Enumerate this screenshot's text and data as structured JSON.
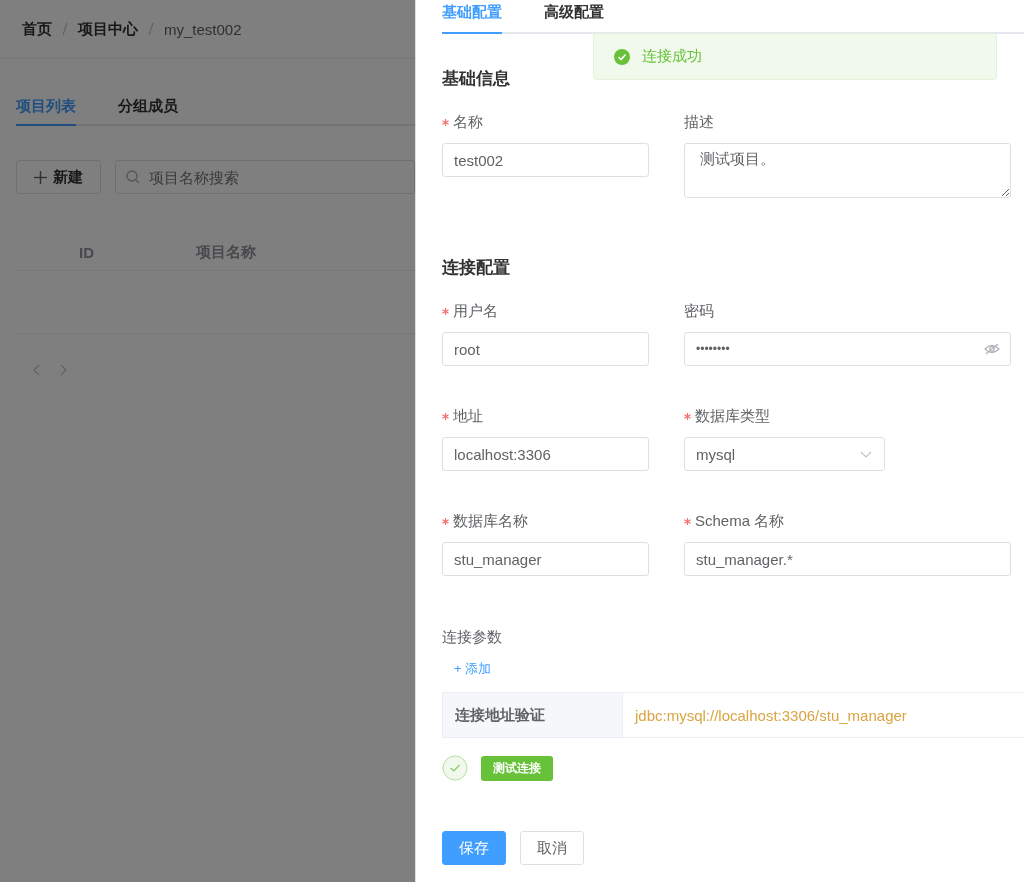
{
  "breadcrumb": [
    {
      "label": "首页"
    },
    {
      "label": "项目中心"
    },
    {
      "label": "my_test002"
    }
  ],
  "page_tabs": [
    {
      "label": "项目列表",
      "selected": true
    },
    {
      "label": "分组成员",
      "selected": false
    }
  ],
  "new_button": "新建",
  "search": {
    "placeholder": "项目名称搜索"
  },
  "table": {
    "columns": [
      "ID",
      "项目名称"
    ]
  },
  "drawer": {
    "tabs": [
      {
        "label": "基础配置",
        "selected": true
      },
      {
        "label": "高级配置",
        "selected": false
      }
    ],
    "sections": [
      {
        "title": "基础信息",
        "fields": [
          {
            "label": "名称",
            "required": true,
            "kind": "input",
            "value": "test002"
          },
          {
            "label": "描述",
            "required": false,
            "kind": "textarea",
            "value": "测试项目。"
          }
        ]
      },
      {
        "title": "连接配置",
        "fields": [
          {
            "label": "用户名",
            "required": true,
            "kind": "input",
            "value": "root"
          },
          {
            "label": "密码",
            "required": false,
            "kind": "password",
            "value": "••••••••"
          },
          {
            "label": "地址",
            "required": true,
            "kind": "input",
            "value": "localhost:3306"
          },
          {
            "label": "数据库类型",
            "required": true,
            "kind": "select",
            "value": "mysql"
          },
          {
            "label": "数据库名称",
            "required": true,
            "kind": "input",
            "value": "stu_manager"
          },
          {
            "label": "Schema 名称",
            "required": true,
            "kind": "input",
            "value": "stu_manager.*"
          }
        ]
      }
    ],
    "params_label": "连接参数",
    "add_link": "+ 添加",
    "verify": {
      "label": "连接地址验证",
      "url": "jdbc:mysql://localhost:3306/stu_manager"
    },
    "test_passed": true,
    "test_button": "测试连接",
    "buttons": [
      {
        "label": "保存",
        "kind": "primary"
      },
      {
        "label": "取消",
        "kind": "default"
      }
    ]
  },
  "toast": {
    "kind": "success",
    "message": "连接成功"
  }
}
